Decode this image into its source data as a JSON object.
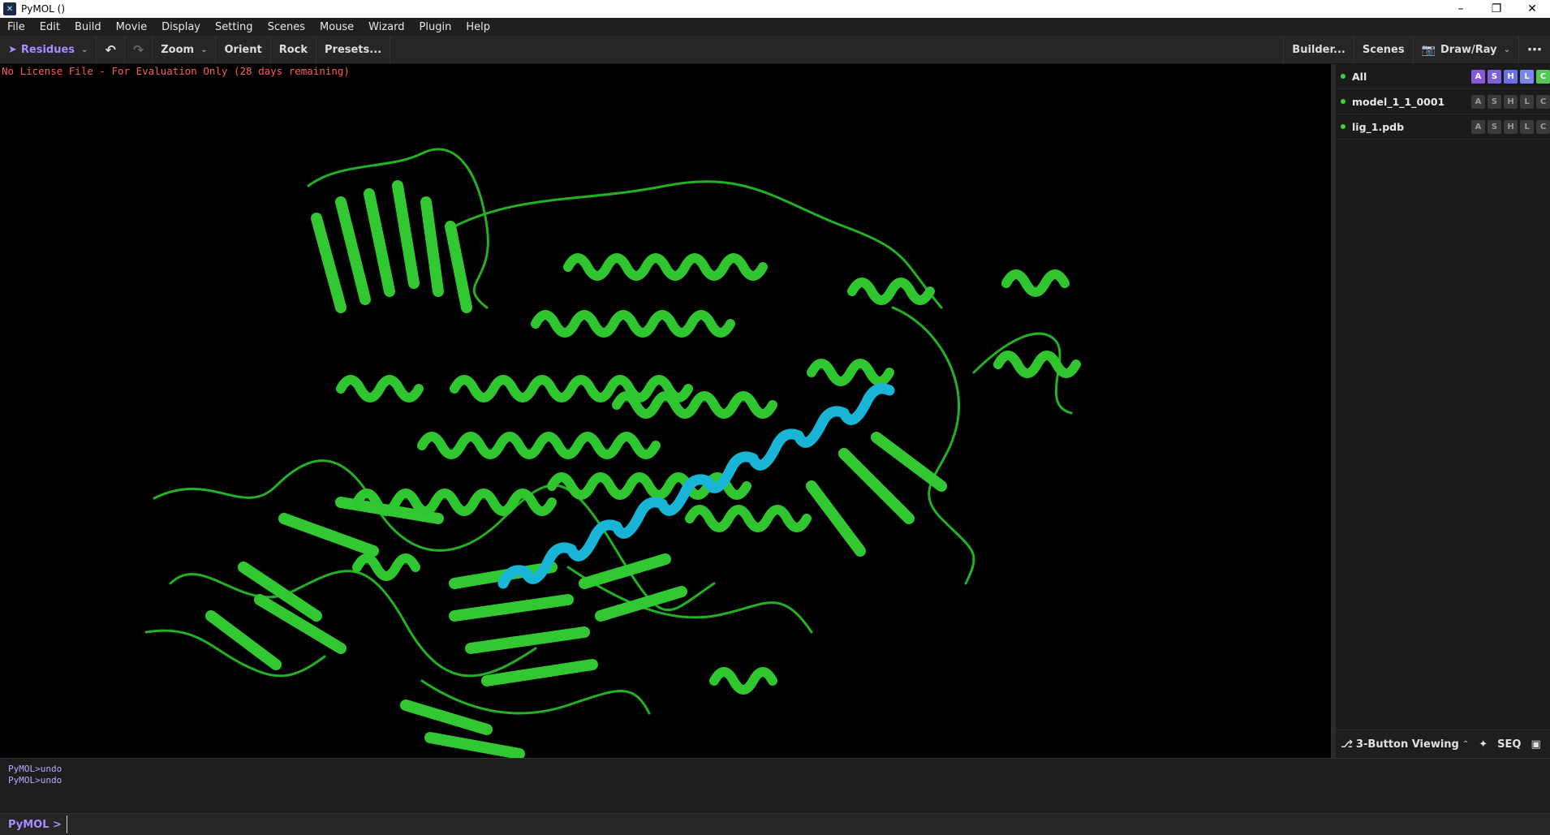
{
  "window": {
    "title": "PyMOL ()"
  },
  "menubar": {
    "items": [
      "File",
      "Edit",
      "Build",
      "Movie",
      "Display",
      "Setting",
      "Scenes",
      "Mouse",
      "Wizard",
      "Plugin",
      "Help"
    ]
  },
  "toolbar": {
    "mode": "Residues",
    "zoom": "Zoom",
    "orient": "Orient",
    "rock": "Rock",
    "presets": "Presets...",
    "builder": "Builder...",
    "scenes": "Scenes",
    "draw_ray": "Draw/Ray"
  },
  "viewport": {
    "license_text": "No License File - For Evaluation Only (28 days remaining)"
  },
  "objects": [
    {
      "name": "All",
      "buttons": [
        "A",
        "S",
        "H",
        "L",
        "C"
      ]
    },
    {
      "name": "model_1_1_0001",
      "buttons": [
        "A",
        "S",
        "H",
        "L",
        "C"
      ]
    },
    {
      "name": "lig_1.pdb",
      "buttons": [
        "A",
        "S",
        "H",
        "L",
        "C"
      ]
    }
  ],
  "side_bottom": {
    "mouse_mode": "3-Button Viewing",
    "seq": "SEQ"
  },
  "console": {
    "lines": [
      "PyMOL>undo",
      "PyMOL>undo"
    ]
  },
  "cmdline": {
    "prompt": "PyMOL >",
    "value": ""
  },
  "colors": {
    "protein": "#2ecc2e",
    "helix_highlight": "#19b5d6",
    "accent": "#a98bff"
  }
}
